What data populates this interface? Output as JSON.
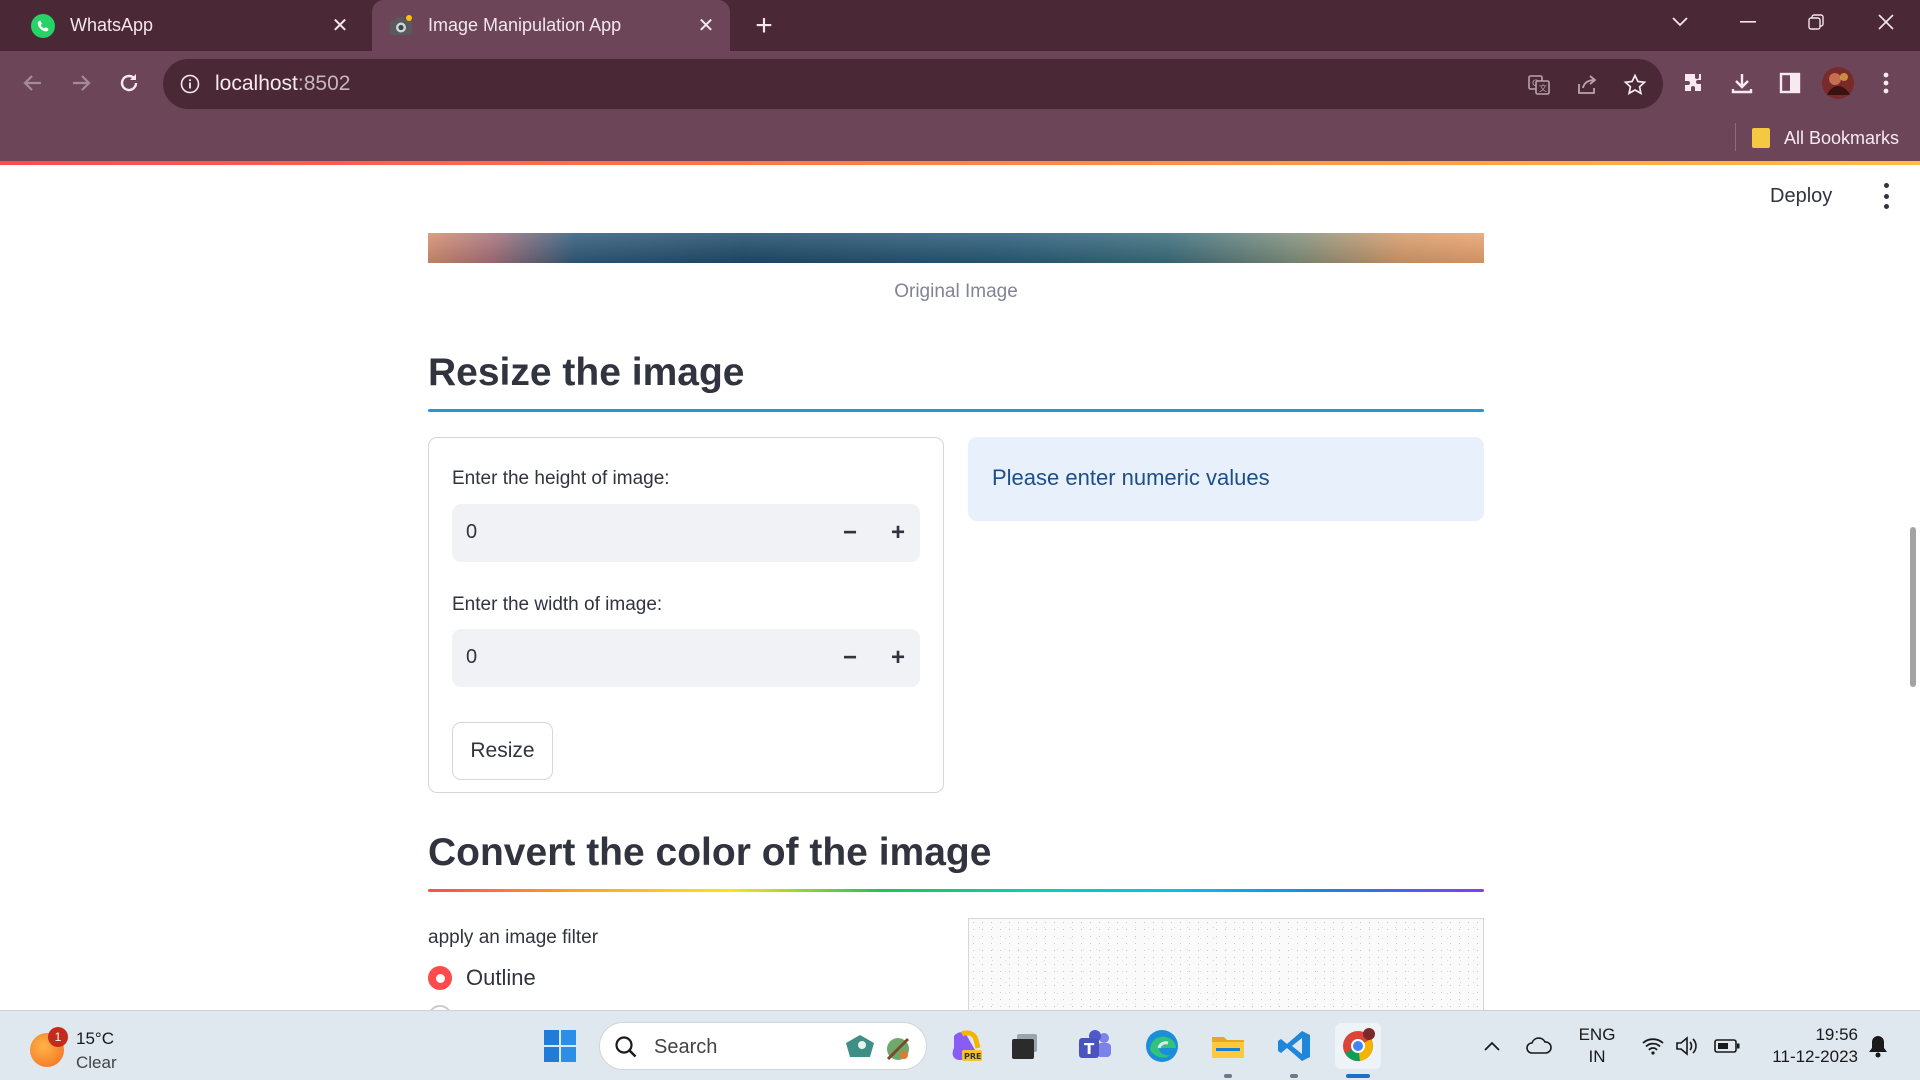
{
  "browser": {
    "tabs": [
      {
        "title": "WhatsApp",
        "icon": "whatsapp-icon"
      },
      {
        "title": "Image Manipulation App",
        "icon": "camera-icon",
        "active": true
      }
    ],
    "url_host": "localhost",
    "url_port": ":8502",
    "bookmarks": {
      "all_label": "All Bookmarks"
    }
  },
  "app": {
    "deploy_label": "Deploy",
    "original_caption": "Original Image",
    "resize": {
      "heading": "Resize the image",
      "height_label": "Enter the height of image:",
      "height_value": "0",
      "width_label": "Enter the width of image:",
      "width_value": "0",
      "button_label": "Resize",
      "info_message": "Please enter numeric values"
    },
    "convert": {
      "heading": "Convert the color of the image",
      "filter_label": "apply an image filter",
      "selected_option": "Outline"
    },
    "colors": {
      "accent": "#ff4b4b",
      "info_bg": "#e8f1fb",
      "info_text": "#1b4f8a",
      "resize_rule": "#2596d8"
    }
  },
  "taskbar": {
    "weather_temp": "15°C",
    "weather_condition": "Clear",
    "weather_badge": "1",
    "search_placeholder": "Search",
    "lang_line1": "ENG",
    "lang_line2": "IN",
    "time": "19:56",
    "date": "11-12-2023"
  }
}
